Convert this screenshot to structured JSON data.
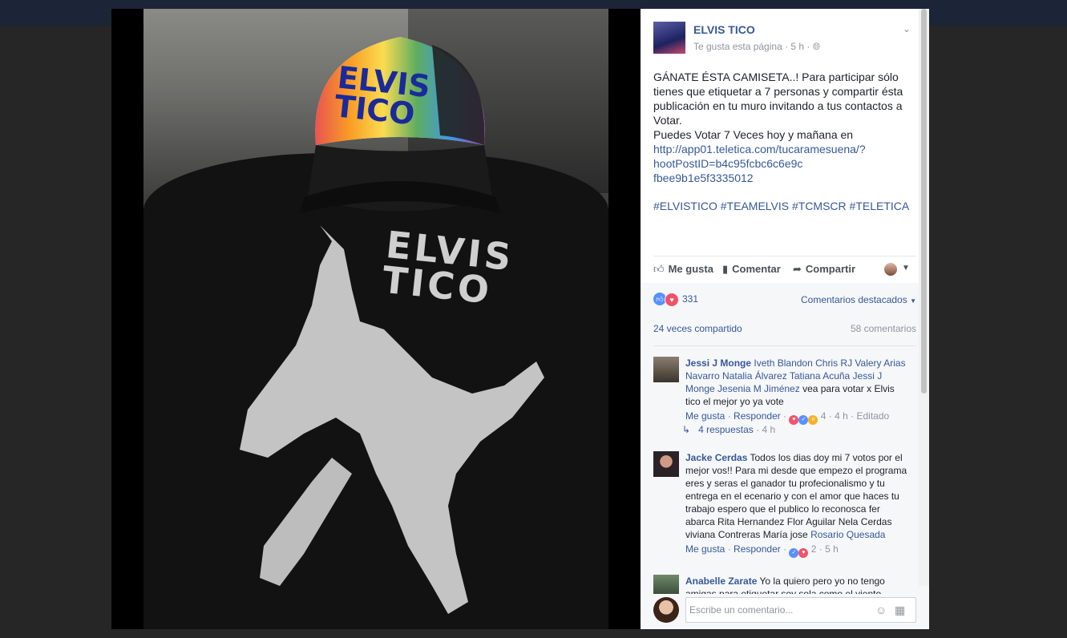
{
  "post": {
    "page_name": "ELVIS TICO",
    "meta": "Te gusta esta página · 5 h · ",
    "globe_icon": "globe-icon",
    "text_main": "GÁNATE ÉSTA CAMISETA..! Para participar sólo tienes que etiquetar a 7 personas y compartir ésta publicación en tu muro invitando a tus contactos a Votar.\nPuedes Votar 7 Veces hoy y mañana en ",
    "link": "http://app01.teletica.com/tucaramesuena/?\nhootPostID=b4c95fcbc6c6e9c\nfbee9b1e5f3335012",
    "hashtags": "#ELVISTICO #TEAMELVIS #TCMSCR #TELETICA"
  },
  "photo": {
    "cap_text": "ELVIS TICO",
    "shirt_text_line1": "ELVIS",
    "shirt_text_line2": "TICO"
  },
  "actions": {
    "like": "Me gusta",
    "comment": "Comentar",
    "share": "Compartir"
  },
  "stats": {
    "reaction_count": "331",
    "sort_label": "Comentarios destacados",
    "shares": "24 veces compartido",
    "comments": "58 comentarios"
  },
  "comments": [
    {
      "name": "Jessi J Monge",
      "tags": "Iveth Blandon Chris RJ Valery Arias Navarro Natalia Álvarez Tatiana Acuña Jessi J Monge Jesenia M Jiménez",
      "text": " vea para votar x Elvis tico el mejor yo ya vote",
      "like": "Me gusta",
      "reply": "Responder",
      "reactions": "4",
      "time": "4 h",
      "edited": "Editado"
    },
    {
      "name": "Jacke Cerdas",
      "text_before": " Todos los dias doy mi 7 votos por el mejor vos!! Para mi desde que empezo el programa eres y seras el ganador tu profecionalismo y tu entrega en el ecenario y con el amor que haces tu trabajo espero que el publico lo reconosca fer abarca Rita Hernandez Flor Aguilar Nela Cerdas viviana Contreras María jose ",
      "tag": "Rosario Quesada",
      "like": "Me gusta",
      "reply": "Responder",
      "reactions": "2",
      "time": "5 h"
    },
    {
      "name": "Anabelle Zarate",
      "text": " Yo la quiero pero yo no tengo amigas para etiquetar soy sola como el viento"
    }
  ],
  "replies": {
    "label": "4 respuestas",
    "time": "4 h"
  },
  "composer": {
    "placeholder": "Escribe un comentario..."
  },
  "colors": {
    "link": "#365899",
    "like_blue": "#5890ff",
    "love_red": "#f25268"
  }
}
